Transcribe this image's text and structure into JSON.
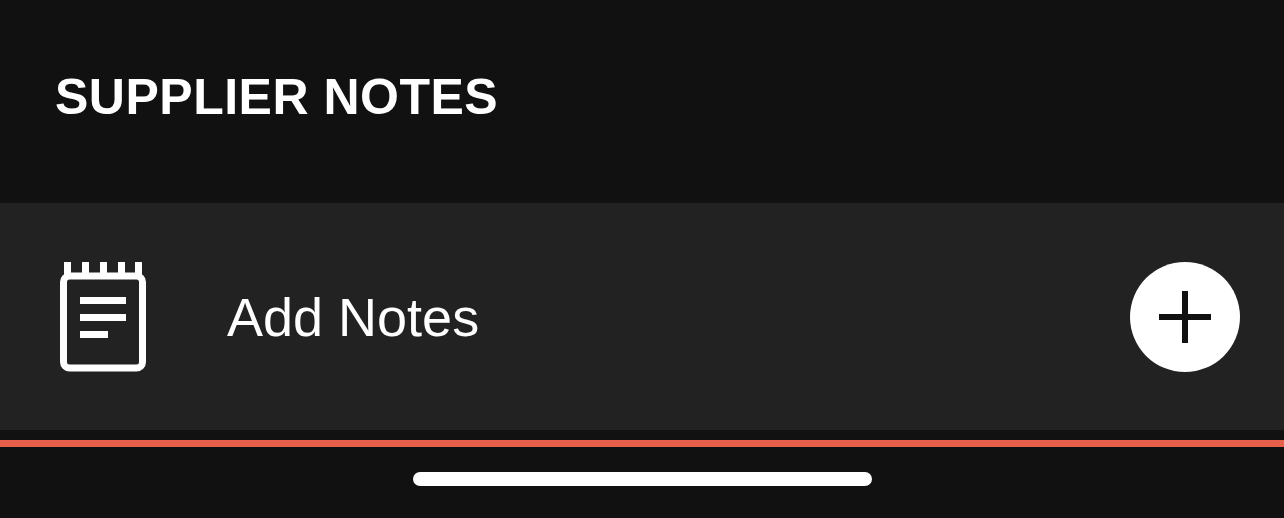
{
  "header": {
    "title": "SUPPLIER NOTES"
  },
  "add_row": {
    "label": "Add Notes"
  }
}
